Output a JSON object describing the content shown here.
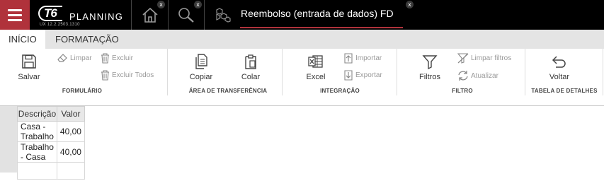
{
  "app": {
    "logo_mark": "T6",
    "logo_word": "PLANNING",
    "version": "UX 12.2.2503.1310",
    "close_glyph": "x",
    "document_tab_title": "Reembolso (entrada de dados) FD",
    "accent_color": "#b0323b"
  },
  "ribbon_tabs": [
    {
      "label": "INÍCIO",
      "active": true
    },
    {
      "label": "FORMATAÇÃO",
      "active": false
    }
  ],
  "ribbon": {
    "formulario": {
      "label": "FORMULÁRIO",
      "save": "Salvar",
      "clear": "Limpar",
      "delete": "Excluir",
      "delete_all": "Excluir Todos"
    },
    "clipboard": {
      "label": "ÁREA DE TRANSFERÊNCIA",
      "copy": "Copiar",
      "paste": "Colar"
    },
    "integracao": {
      "label": "INTEGRAÇÃO",
      "excel": "Excel",
      "import": "Importar",
      "export": "Exportar"
    },
    "filtro": {
      "label": "FILTRO",
      "filters": "Filtros",
      "clear_filters": "Limpar filtros",
      "refresh": "Atualizar"
    },
    "detalhes": {
      "label": "TABELA DE DETALHES",
      "back": "Voltar"
    }
  },
  "grid": {
    "columns": [
      "Descrição",
      "Valor"
    ],
    "rows": [
      [
        "Casa - Trabalho",
        "40,00"
      ],
      [
        "Trabalho - Casa",
        "40,00"
      ],
      [
        "",
        ""
      ]
    ]
  }
}
